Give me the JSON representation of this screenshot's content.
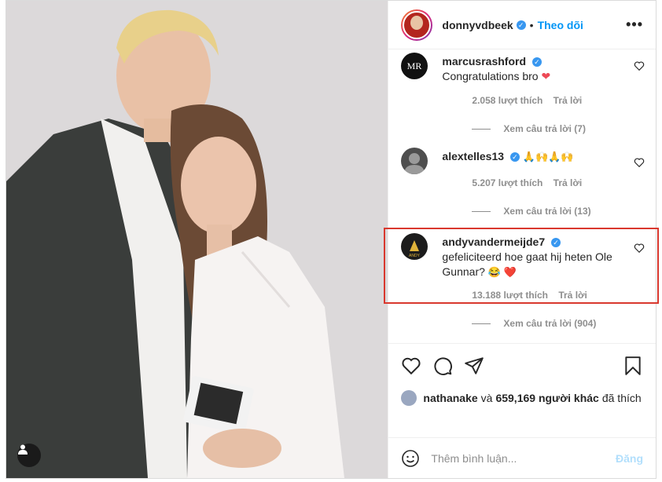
{
  "post": {
    "author": "donnyvdbeek",
    "follow_label": "Theo dõi",
    "dot": "•",
    "more_label": "•••"
  },
  "comments": [
    {
      "user": "marcusrashford",
      "text": "Congratulations bro",
      "emoji": "❤️",
      "likes": "2.058 lượt thích",
      "reply_label": "Trả lời",
      "view_replies": "Xem câu trả lời (7)",
      "avatar_color": "#111111"
    },
    {
      "user": "alextelles13",
      "text": "",
      "emoji": "🙏🙌🙏🙌",
      "likes": "5.207 lượt thích",
      "reply_label": "Trả lời",
      "view_replies": "Xem câu trả lời (13)",
      "avatar_color": "#555555"
    },
    {
      "user": "andyvandermeijde7",
      "text": "gefeliciteerd hoe gaat hij heten Ole Gunnar?",
      "emoji": "😂 ❤️",
      "likes": "13.188 lượt thích",
      "reply_label": "Trả lời",
      "view_replies": "Xem câu trả lời (904)",
      "avatar_color": "#1c1c1c"
    }
  ],
  "likes_summary": {
    "user": "nathanake",
    "conj": "và",
    "count": "659,169 người khác",
    "suffix": "đã thích"
  },
  "add_comment": {
    "placeholder": "Thêm bình luận...",
    "post_label": "Đăng"
  },
  "colors": {
    "accent": "#0095f6",
    "highlight": "#d9382e",
    "heart": "#ed4956"
  }
}
